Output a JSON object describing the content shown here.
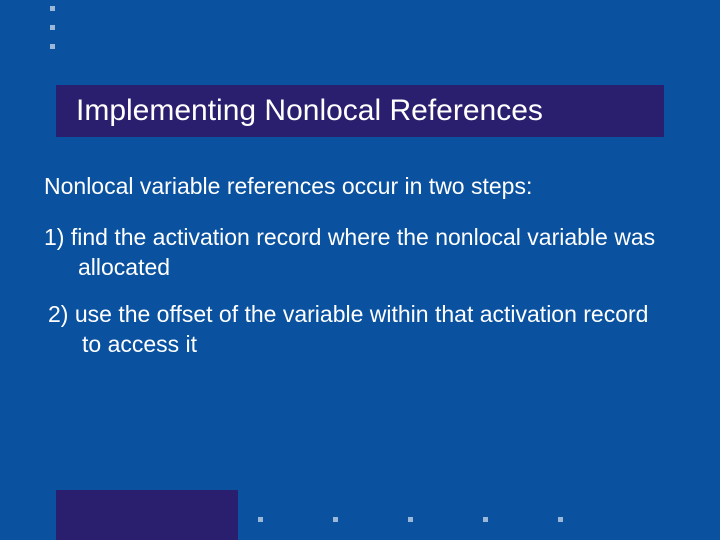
{
  "title": "Implementing Nonlocal References",
  "intro": "Nonlocal variable references occur in two steps:",
  "items": [
    "1)  find the activation record where the nonlocal variable was allocated",
    "2) use the offset of the variable within that activation record to access it"
  ],
  "colors": {
    "background": "#0a52a0",
    "accent": "#2a1e6e",
    "text": "#ffffff",
    "dot": "#9bb8d8"
  }
}
